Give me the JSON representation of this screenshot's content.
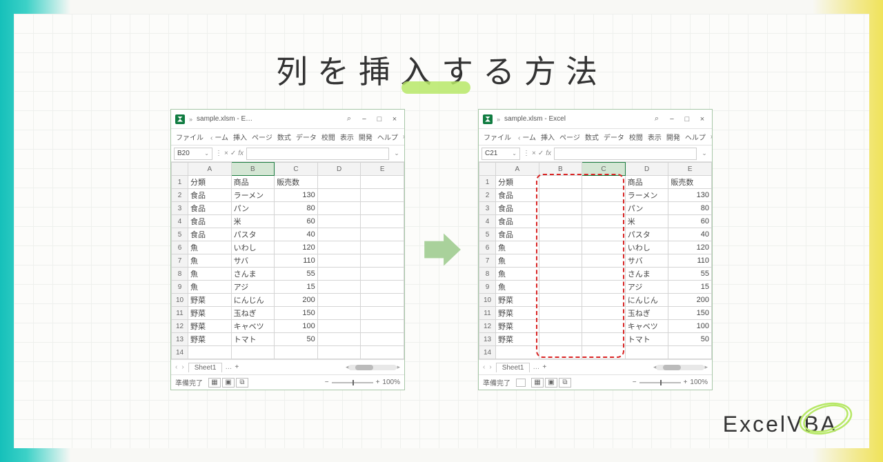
{
  "title": "列を挿入する方法",
  "brand": "ExcelVBA",
  "window": {
    "filename_left": "sample.xlsm - E…",
    "filename_right": "sample.xlsm - Excel",
    "search_icon": "search",
    "buttons": {
      "min": "−",
      "max": "□",
      "close": "×"
    }
  },
  "ribbon": [
    "ファイル",
    "ーム",
    "挿入",
    "ページ",
    "数式",
    "データ",
    "校閲",
    "表示",
    "開発",
    "ヘルプ"
  ],
  "status": {
    "ready": "準備完了",
    "zoom": "100%"
  },
  "sheet_tab": "Sheet1",
  "left": {
    "namebox": "B20",
    "cols": [
      "A",
      "B",
      "C",
      "D",
      "E"
    ],
    "selected_col": "B",
    "rows": [
      [
        "分類",
        "商品",
        "販売数",
        "",
        ""
      ],
      [
        "食品",
        "ラーメン",
        "130",
        "",
        ""
      ],
      [
        "食品",
        "パン",
        "80",
        "",
        ""
      ],
      [
        "食品",
        "米",
        "60",
        "",
        ""
      ],
      [
        "食品",
        "パスタ",
        "40",
        "",
        ""
      ],
      [
        "魚",
        "いわし",
        "120",
        "",
        ""
      ],
      [
        "魚",
        "サバ",
        "110",
        "",
        ""
      ],
      [
        "魚",
        "さんま",
        "55",
        "",
        ""
      ],
      [
        "魚",
        "アジ",
        "15",
        "",
        ""
      ],
      [
        "野菜",
        "にんじん",
        "200",
        "",
        ""
      ],
      [
        "野菜",
        "玉ねぎ",
        "150",
        "",
        ""
      ],
      [
        "野菜",
        "キャベツ",
        "100",
        "",
        ""
      ],
      [
        "野菜",
        "トマト",
        "50",
        "",
        ""
      ]
    ]
  },
  "right": {
    "namebox": "C21",
    "cols": [
      "A",
      "B",
      "C",
      "D",
      "E"
    ],
    "selected_col": "C",
    "rows": [
      [
        "分類",
        "",
        "",
        "商品",
        "販売数"
      ],
      [
        "食品",
        "",
        "",
        "ラーメン",
        "130"
      ],
      [
        "食品",
        "",
        "",
        "パン",
        "80"
      ],
      [
        "食品",
        "",
        "",
        "米",
        "60"
      ],
      [
        "食品",
        "",
        "",
        "パスタ",
        "40"
      ],
      [
        "魚",
        "",
        "",
        "いわし",
        "120"
      ],
      [
        "魚",
        "",
        "",
        "サバ",
        "110"
      ],
      [
        "魚",
        "",
        "",
        "さんま",
        "55"
      ],
      [
        "魚",
        "",
        "",
        "アジ",
        "15"
      ],
      [
        "野菜",
        "",
        "",
        "にんじん",
        "200"
      ],
      [
        "野菜",
        "",
        "",
        "玉ねぎ",
        "150"
      ],
      [
        "野菜",
        "",
        "",
        "キャベツ",
        "100"
      ],
      [
        "野菜",
        "",
        "",
        "トマト",
        "50"
      ]
    ]
  },
  "chart_data": {
    "type": "table",
    "title": "列を挿入する方法",
    "before": {
      "columns": [
        "分類",
        "商品",
        "販売数"
      ],
      "rows": [
        [
          "食品",
          "ラーメン",
          130
        ],
        [
          "食品",
          "パン",
          80
        ],
        [
          "食品",
          "米",
          60
        ],
        [
          "食品",
          "パスタ",
          40
        ],
        [
          "魚",
          "いわし",
          120
        ],
        [
          "魚",
          "サバ",
          110
        ],
        [
          "魚",
          "さんま",
          55
        ],
        [
          "魚",
          "アジ",
          15
        ],
        [
          "野菜",
          "にんじん",
          200
        ],
        [
          "野菜",
          "玉ねぎ",
          150
        ],
        [
          "野菜",
          "キャベツ",
          100
        ],
        [
          "野菜",
          "トマト",
          50
        ]
      ]
    },
    "after_note": "Two blank columns inserted at B and C; 商品/販売数 shifted to D/E"
  }
}
